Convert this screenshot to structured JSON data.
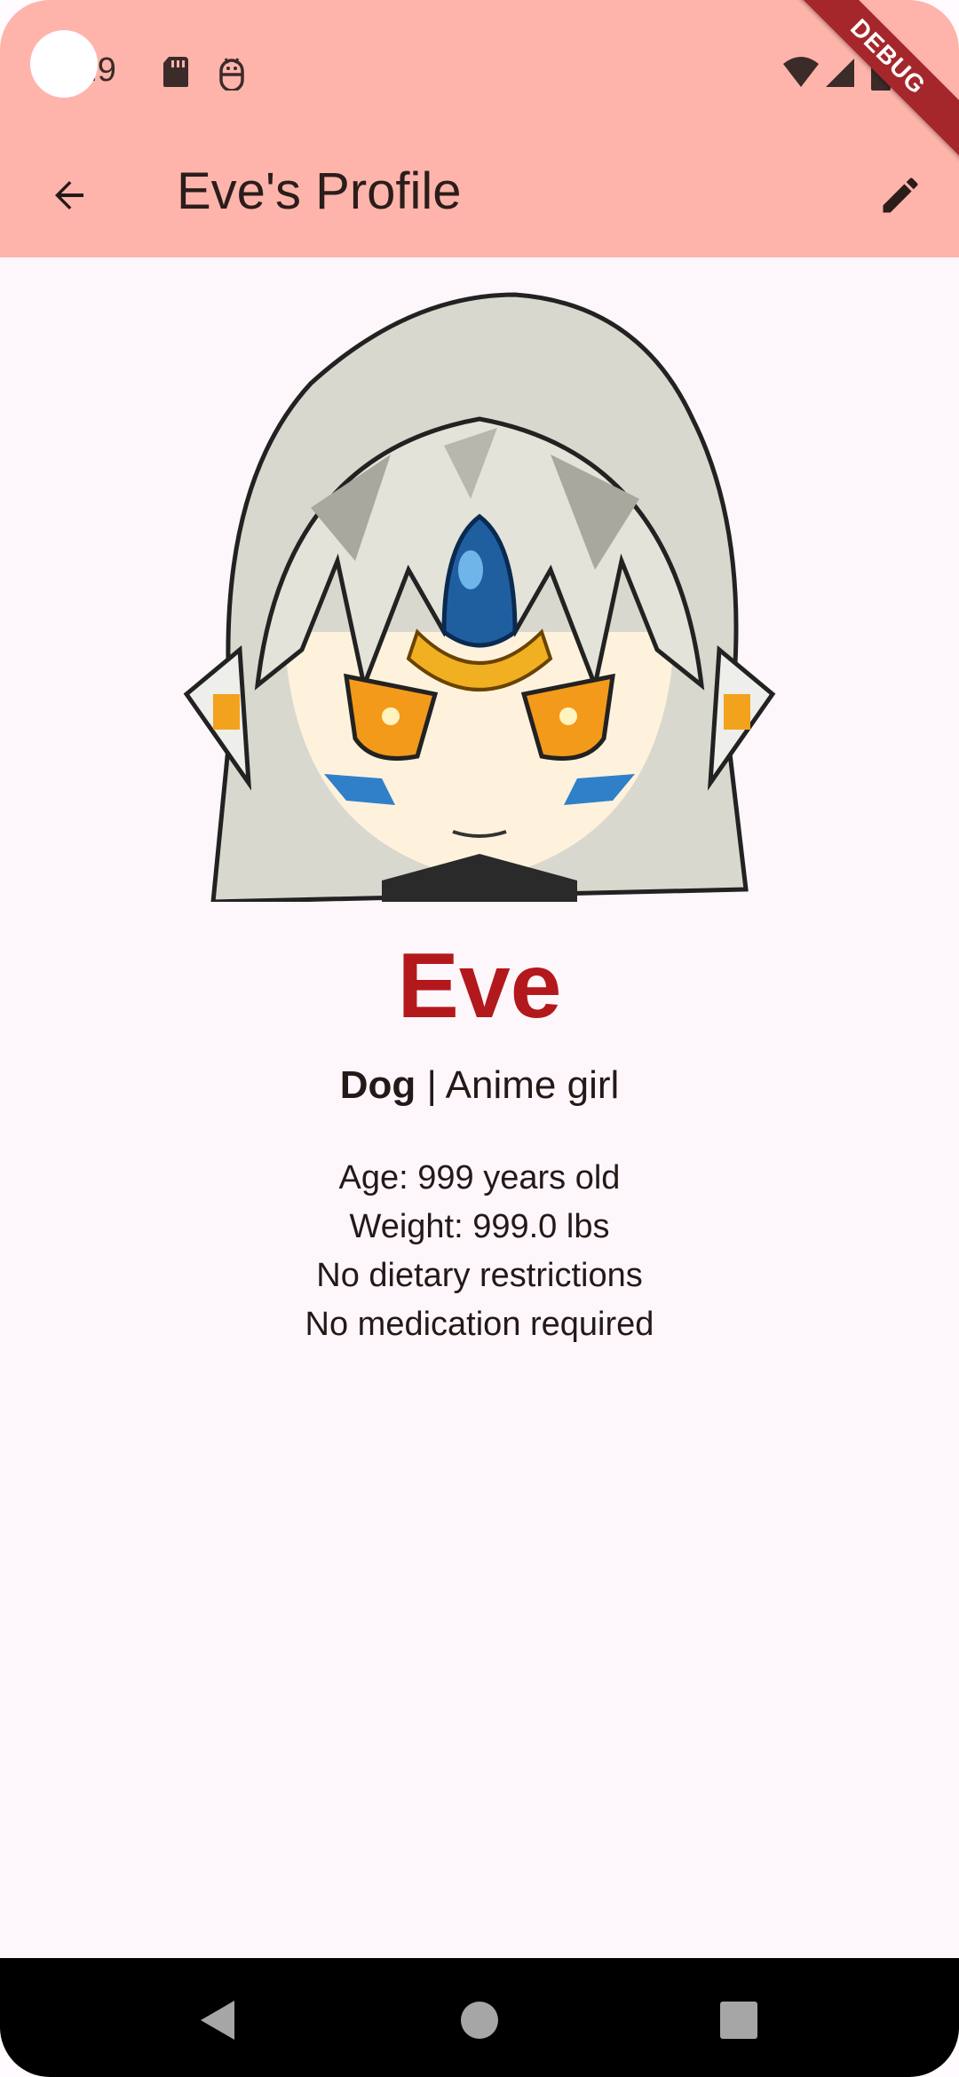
{
  "status_bar": {
    "time": ":19",
    "icons": [
      "sd-card-icon",
      "android-debug-icon",
      "wifi-icon",
      "signal-icon",
      "battery-icon"
    ]
  },
  "app_bar": {
    "title": "Eve's Profile",
    "back_icon": "arrow-back-icon",
    "edit_icon": "pencil-edit-icon"
  },
  "debug_banner": "DEBUG",
  "profile": {
    "name": "Eve",
    "species": "Dog",
    "separator": " | ",
    "breed": "Anime girl",
    "details": [
      "Age: 999 years old",
      "Weight: 999.0 lbs",
      "No dietary restrictions",
      "No medication required"
    ]
  },
  "nav_bar": {
    "back": "nav-back-icon",
    "home": "nav-home-icon",
    "recents": "nav-recents-icon"
  },
  "colors": {
    "app_bar_bg": "#ffb4ab",
    "name_color": "#b3191c",
    "background": "#fdf7fb",
    "debug_banner": "#a5262b"
  }
}
